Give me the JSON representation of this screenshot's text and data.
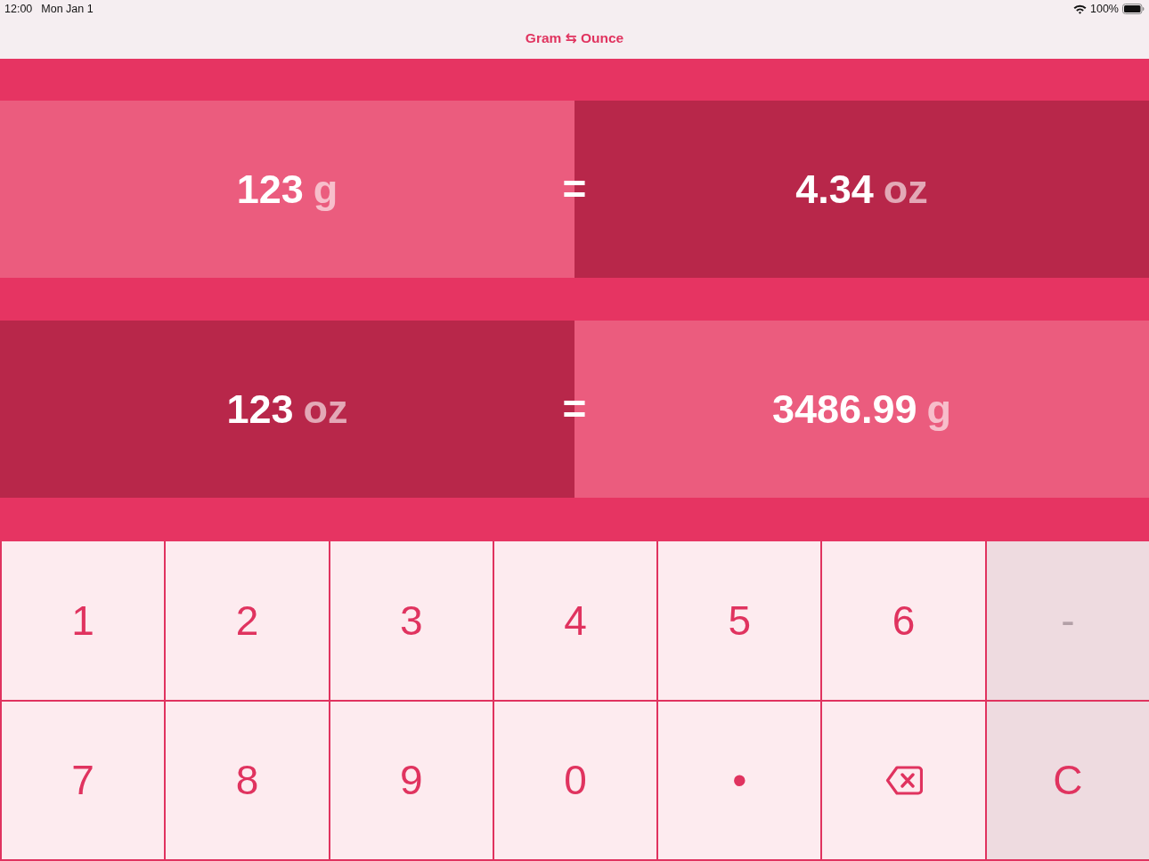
{
  "status_bar": {
    "time": "12:00",
    "date": "Mon Jan 1",
    "battery": "100%"
  },
  "nav_bar": {
    "title": "Gram ⇆ Ounce"
  },
  "conversions": [
    {
      "input": {
        "value": "123",
        "unit": "g",
        "kind": "light"
      },
      "equals": "=",
      "result": {
        "value": "4.34",
        "unit": "oz",
        "kind": "dark"
      }
    },
    {
      "input": {
        "value": "123",
        "unit": "oz",
        "kind": "dark"
      },
      "equals": "=",
      "result": {
        "value": "3486.99",
        "unit": "g",
        "kind": "light"
      }
    }
  ],
  "keypad": {
    "keys": [
      {
        "label": "1",
        "kind": "digit",
        "disabled": false
      },
      {
        "label": "2",
        "kind": "digit",
        "disabled": false
      },
      {
        "label": "3",
        "kind": "digit",
        "disabled": false
      },
      {
        "label": "4",
        "kind": "digit",
        "disabled": false
      },
      {
        "label": "5",
        "kind": "digit",
        "disabled": false
      },
      {
        "label": "6",
        "kind": "digit",
        "disabled": false
      },
      {
        "label": "-",
        "kind": "action",
        "disabled": true
      },
      {
        "label": "7",
        "kind": "digit",
        "disabled": false
      },
      {
        "label": "8",
        "kind": "digit",
        "disabled": false
      },
      {
        "label": "9",
        "kind": "digit",
        "disabled": false
      },
      {
        "label": "0",
        "kind": "digit",
        "disabled": false
      },
      {
        "label": "•",
        "kind": "digit",
        "disabled": false
      },
      {
        "kind": "backspace",
        "disabled": false
      },
      {
        "label": "C",
        "kind": "action",
        "disabled": false
      }
    ]
  }
}
